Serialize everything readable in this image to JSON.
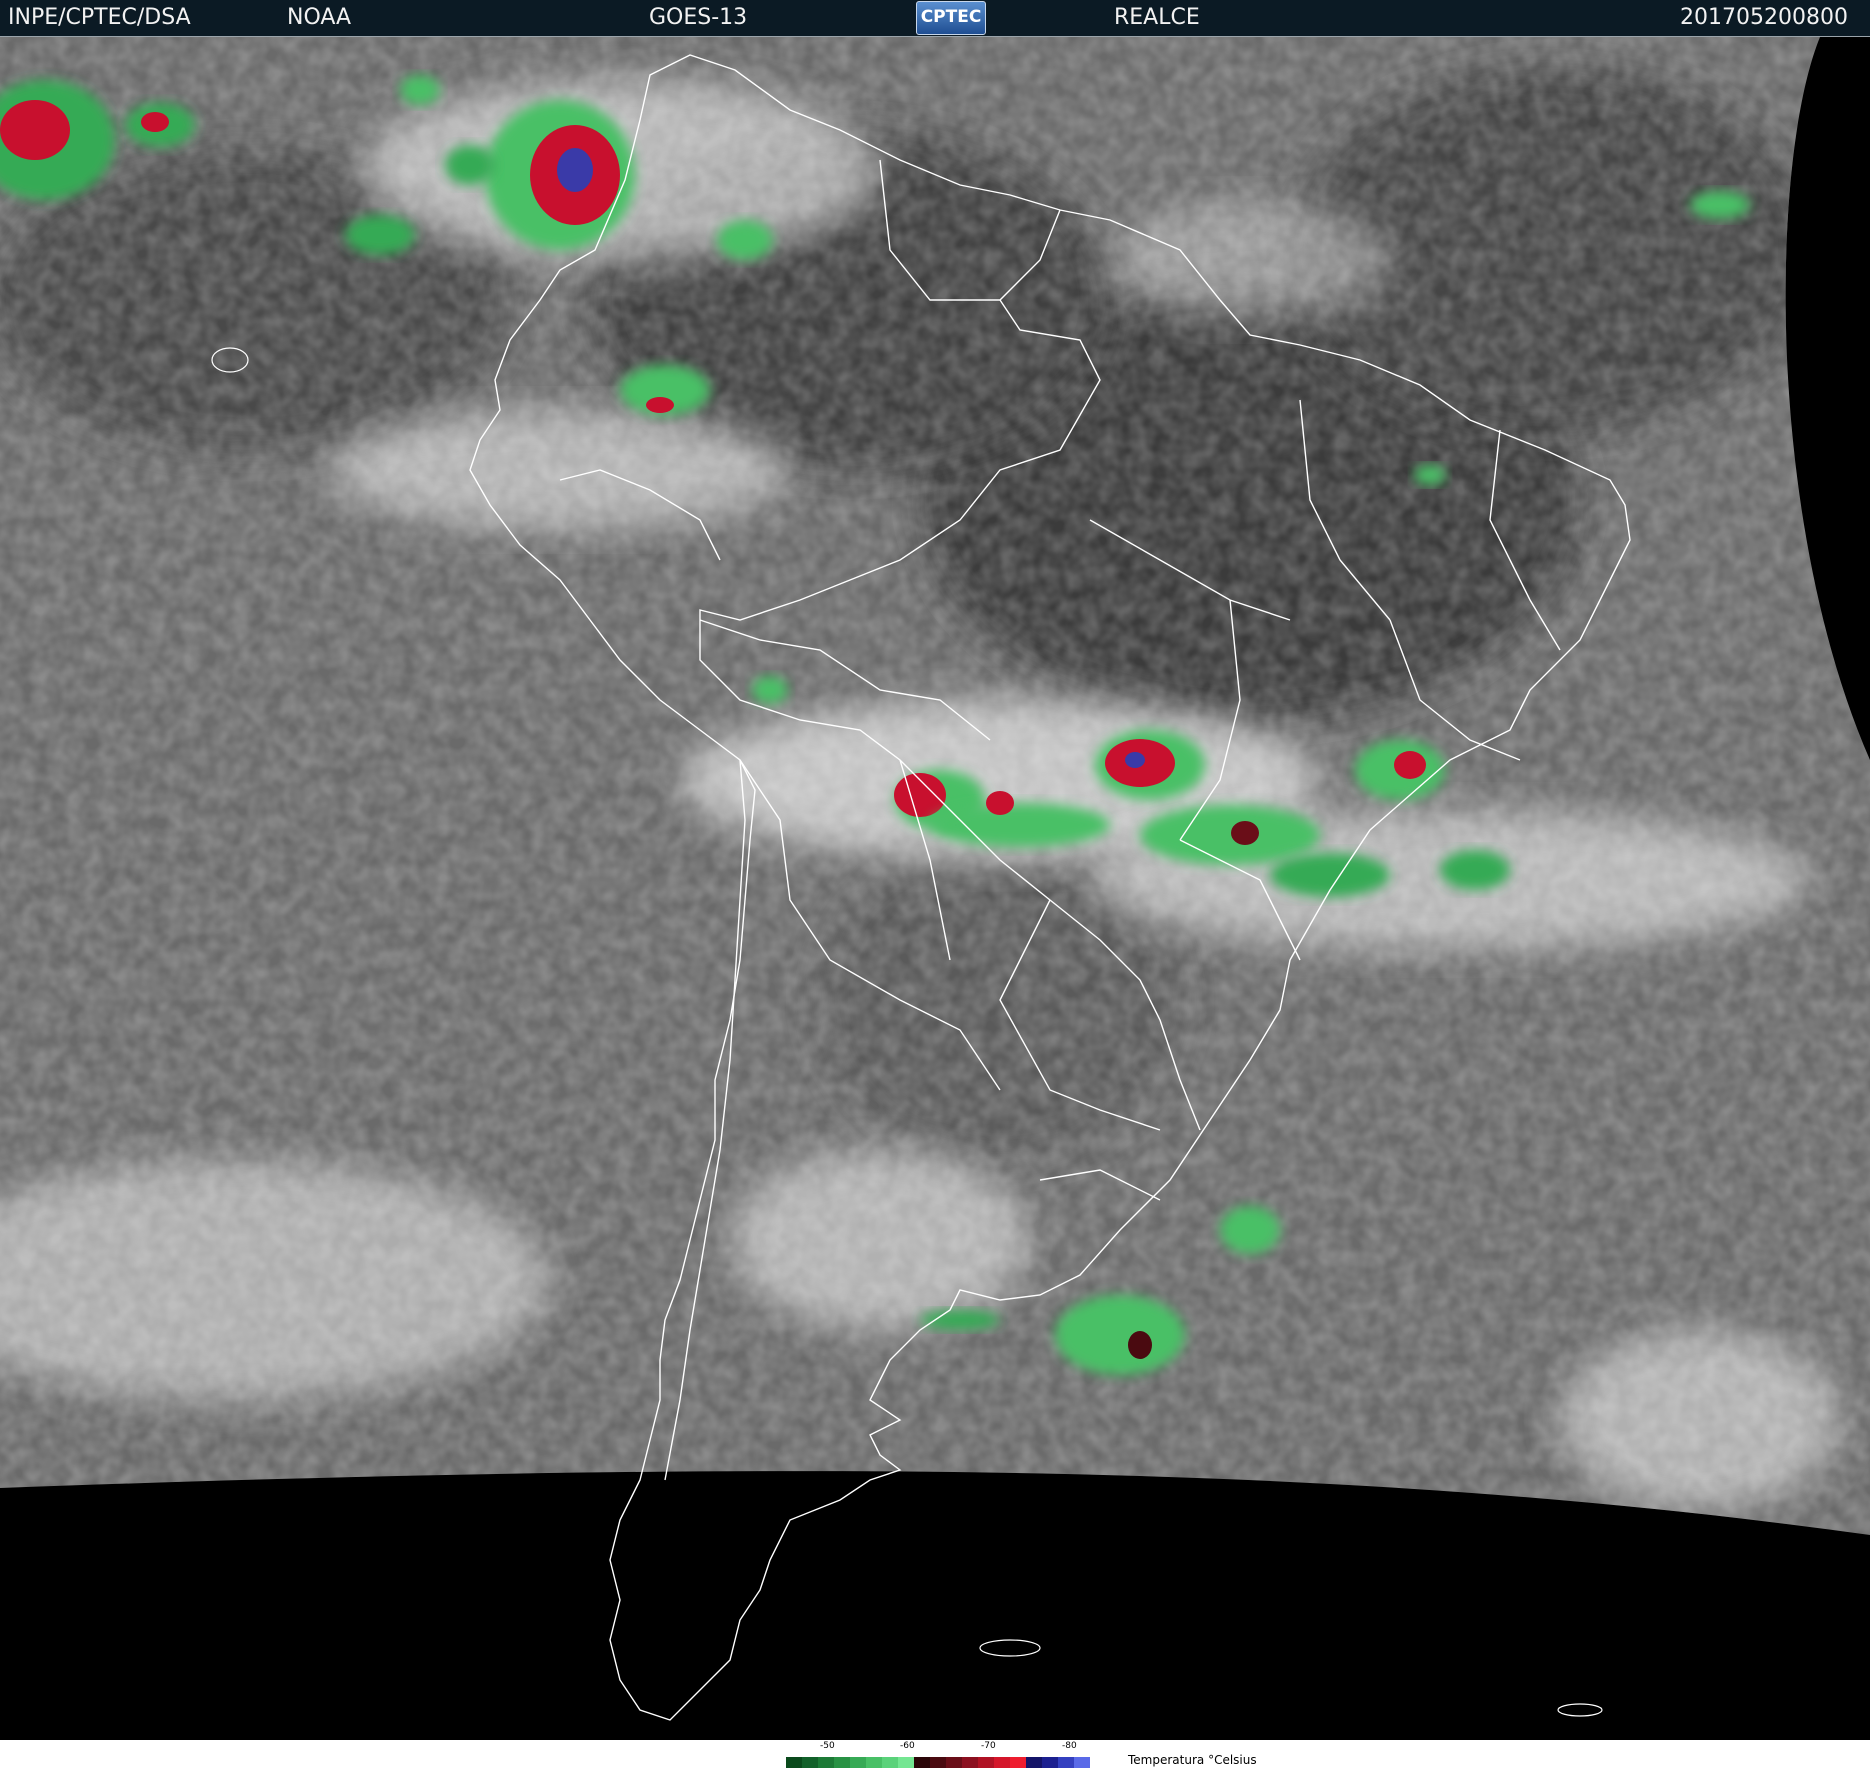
{
  "header": {
    "source": "INPE/CPTEC/DSA",
    "agency": "NOAA",
    "satellite": "GOES-13",
    "logo_text": "CPTEC",
    "enhancement": "REALCE",
    "timestamp": "201705200800"
  },
  "map": {
    "region": "South America",
    "background_color": "#000000",
    "ocean_tone": "#6a6a6a",
    "border_color": "#ffffff",
    "cold_cloud_colors": [
      "#2faa55",
      "#6ee08a",
      "#c8102e",
      "#3a3aa8"
    ]
  },
  "legend": {
    "title": "Temperatura °Celsius",
    "tick_labels": [
      "-50",
      "-60",
      "-70",
      "-80"
    ],
    "colors": [
      "#0a4a1c",
      "#12612a",
      "#1c7a36",
      "#289244",
      "#36aa55",
      "#48c066",
      "#5ad27a",
      "#74e692",
      "#2a0608",
      "#4a0a10",
      "#6a0e18",
      "#8c1020",
      "#b01224",
      "#d4162a",
      "#ee1c2e",
      "#141468",
      "#1c2090",
      "#3440c0",
      "#5a6ae8"
    ]
  }
}
